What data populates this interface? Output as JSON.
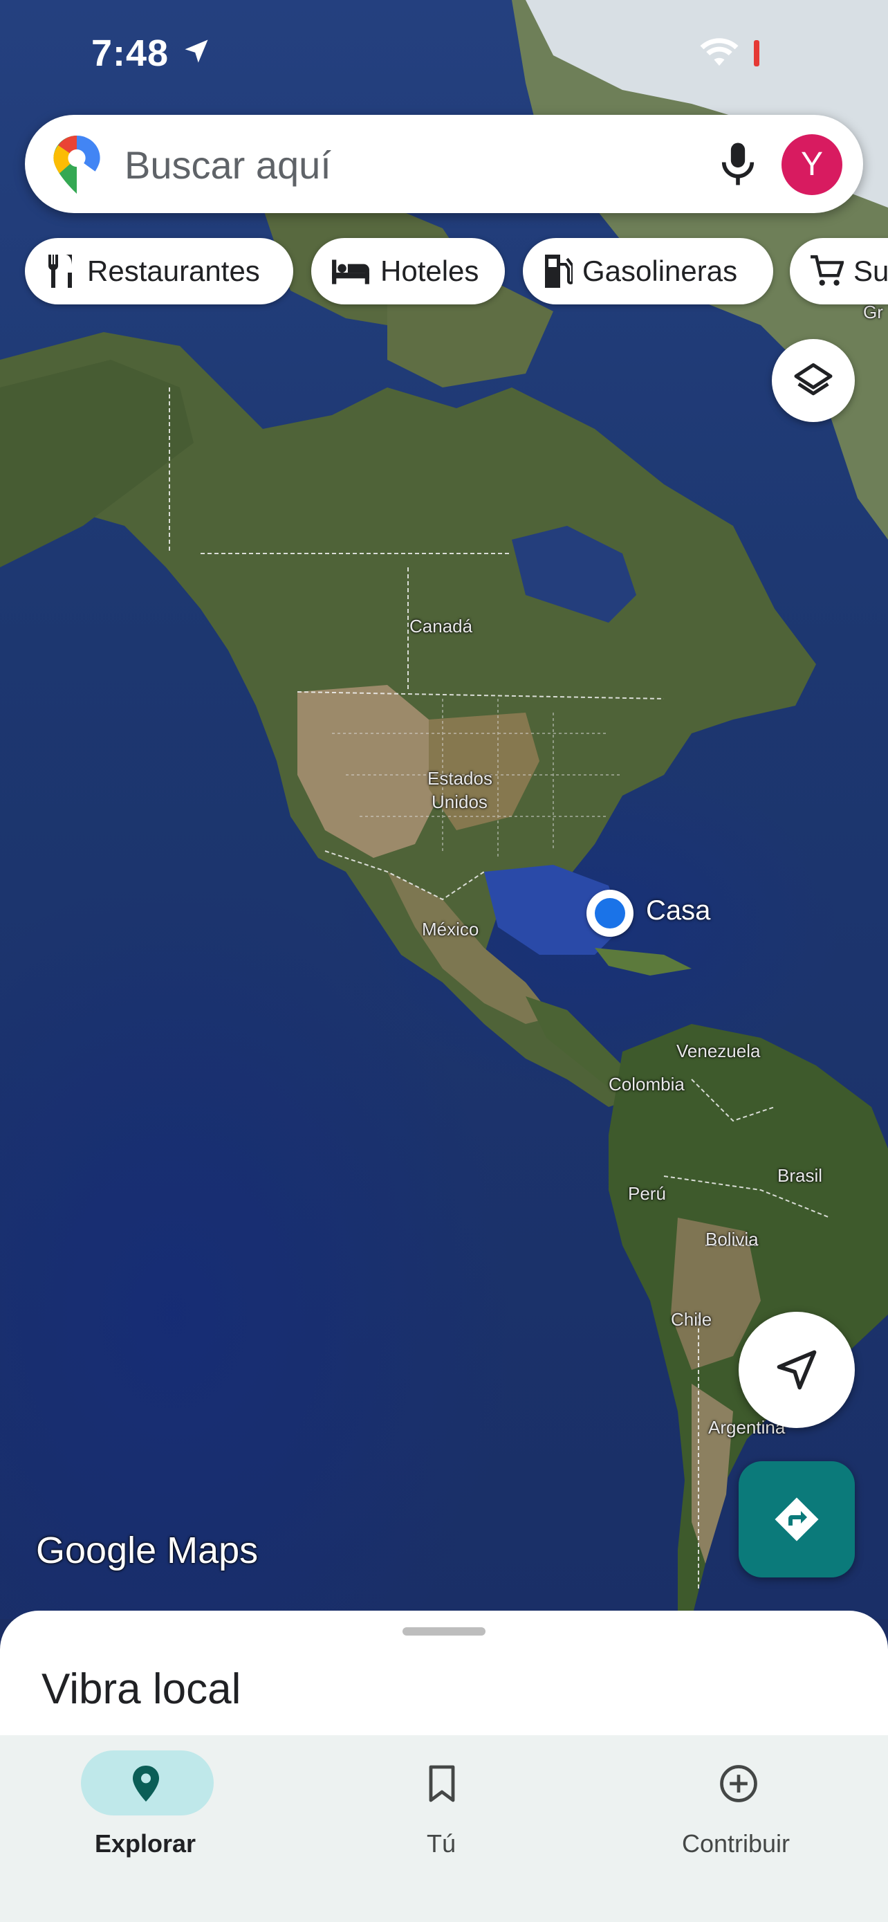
{
  "status_bar": {
    "time": "7:48"
  },
  "search": {
    "placeholder": "Buscar aquí",
    "avatar_letter": "Y"
  },
  "chips": [
    {
      "label": "Restaurantes",
      "icon": "fork-knife-icon"
    },
    {
      "label": "Hoteles",
      "icon": "bed-icon"
    },
    {
      "label": "Gasolineras",
      "icon": "gas-station-icon"
    },
    {
      "label": "Supermercados",
      "icon": "cart-icon"
    }
  ],
  "map": {
    "labels": {
      "canada": "Canadá",
      "usa_line1": "Estados",
      "usa_line2": "Unidos",
      "mexico": "México",
      "venezuela": "Venezuela",
      "colombia": "Colombia",
      "peru": "Perú",
      "brasil": "Brasil",
      "bolivia": "Bolivia",
      "chile": "Chile",
      "argentina": "Argentina",
      "greenland_partial": "Gr"
    },
    "home_label": "Casa",
    "logo": "Google Maps"
  },
  "sheet": {
    "title": "Vibra local"
  },
  "bottom_nav": [
    {
      "label": "Explorar",
      "icon": "location-pin-icon",
      "active": true
    },
    {
      "label": "Tú",
      "icon": "bookmark-icon",
      "active": false
    },
    {
      "label": "Contribuir",
      "icon": "add-circle-icon",
      "active": false
    }
  ],
  "colors": {
    "accent_teal": "#0b7a7a",
    "avatar": "#d81b60",
    "home_dot": "#1a73e8",
    "nav_active_pill": "#bfe8ea"
  }
}
